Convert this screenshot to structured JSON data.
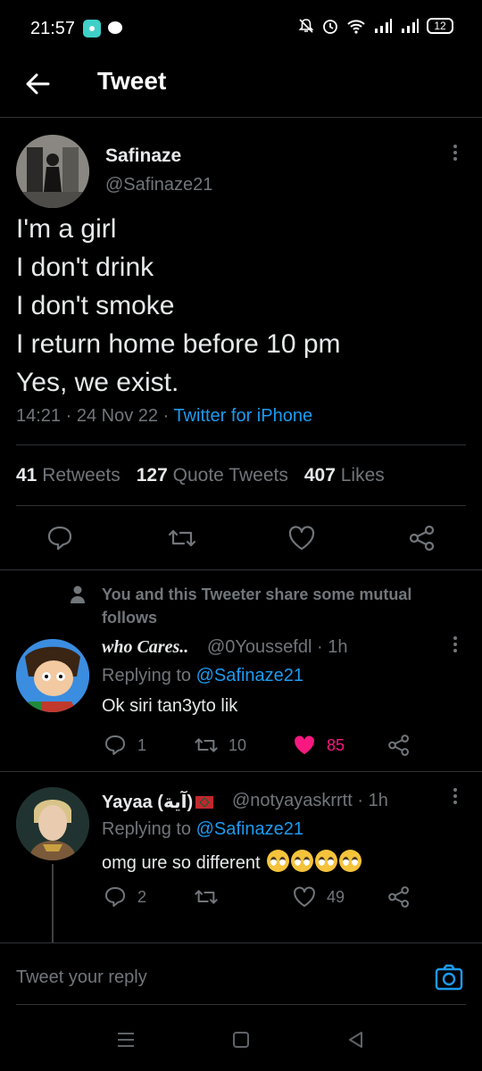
{
  "status_bar": {
    "time": "21:57",
    "battery": "12"
  },
  "header": {
    "title": "Tweet"
  },
  "tweet": {
    "name": "Safinaze",
    "handle": "@Safinaze21",
    "lines": [
      "I'm a girl",
      "I don't drink",
      "I don't smoke",
      "I return home before 10 pm",
      "Yes, we exist."
    ],
    "time": "14:21",
    "date": "24 Nov 22",
    "source": "Twitter for iPhone",
    "retweets": "41",
    "retweets_label": "Retweets",
    "quotes": "127",
    "quotes_label": "Quote Tweets",
    "likes": "407",
    "likes_label": "Likes"
  },
  "notice": {
    "text": "You and this Tweeter share some mutual follows"
  },
  "replies": [
    {
      "name": "who Cares..",
      "handle": "@0Youssefdl",
      "time": "1h",
      "replying_prefix": "Replying to",
      "replying_to": "@Safinaze21",
      "text": "Ok siri tan3yto lik",
      "reply_count": "1",
      "retweet_count": "10",
      "like_count": "85",
      "liked": true
    },
    {
      "name": "Yayaa (آية)",
      "handle": "@notyayaskrrtt",
      "time": "1h",
      "replying_prefix": "Replying to",
      "replying_to": "@Safinaze21",
      "text": "omg ure so different",
      "reply_count": "2",
      "retweet_count": "",
      "like_count": "49",
      "liked": false
    }
  ],
  "composer": {
    "placeholder": "Tweet your reply"
  },
  "colors": {
    "background": "#000000",
    "accent": "#1d9bf0",
    "like": "#f91880",
    "muted": "#71767b"
  }
}
